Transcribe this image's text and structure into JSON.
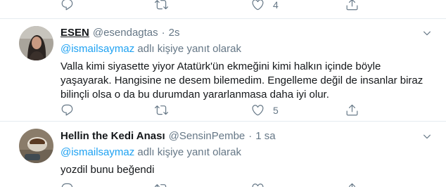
{
  "top_actions": {
    "like_count": "4"
  },
  "tweets": [
    {
      "display_name": "ESEN",
      "handle": "@esendagtas",
      "separator": "·",
      "time": "2s",
      "reply_mention": "@ismailsaymaz",
      "reply_suffix": " adlı kişiye yanıt olarak",
      "body": [
        "Valla kimi siyasette yiyor Atatürk'ün ekmeğini kimi halkın içinde böyle",
        "yaşayarak. Hangisine ne desem bilemedim. Engelleme değil de insanlar biraz",
        "bilinçli olsa o da bu durumdan yararlanmasa daha iyi olur."
      ],
      "like_count": "5",
      "avatar_colors": {
        "bg": "#a9a49b",
        "hair": "#2b2421",
        "face": "#c99a82"
      }
    },
    {
      "display_name": "Hellin the Kedi Anası",
      "handle": "@SensinPembe",
      "separator": "·",
      "time": "1 sa",
      "reply_mention": "@ismailsaymaz",
      "reply_suffix": " adlı kişiye yanıt olarak",
      "body": [
        "yozdil bunu beğendi"
      ],
      "avatar_colors": {
        "bg": "#8a7c6a",
        "cup": "#e9e2d6",
        "drink": "#5a3a22"
      }
    }
  ],
  "icons": {
    "reply": "reply-icon",
    "retweet": "retweet-icon",
    "like": "heart-icon",
    "share": "share-icon",
    "caret": "chevron-down-icon"
  },
  "colors": {
    "link": "#1da1f2",
    "muted": "#657786",
    "text": "#14171a",
    "divider": "#e6ecf0"
  }
}
